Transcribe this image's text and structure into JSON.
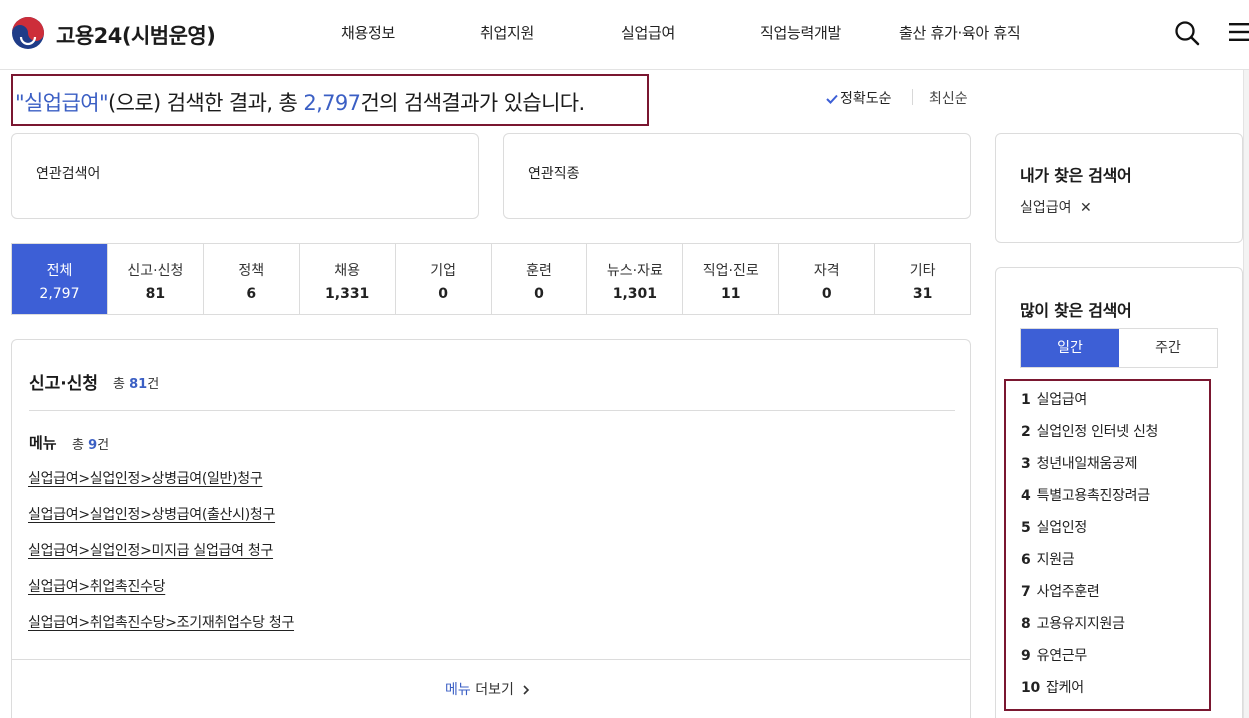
{
  "header": {
    "brand": "고용24(시범운영)",
    "nav": [
      "채용정보",
      "취업지원",
      "실업급여",
      "직업능력개발",
      "출산 휴가·육아 휴직"
    ],
    "icons": [
      "search-icon",
      "hamburger-menu-icon"
    ]
  },
  "result": {
    "keyword_quoted": "\"실업급여\"",
    "mid_text": "(으로) 검색한 결과, 총 ",
    "total": "2,797",
    "end_text": "건의 검색결과가 있습니다."
  },
  "sort": {
    "accuracy": "정확도순",
    "latest": "최신순"
  },
  "related": {
    "keywords_title": "연관검색어",
    "jobs_title": "연관직종"
  },
  "tabs": [
    {
      "label": "전체",
      "count": "2,797"
    },
    {
      "label": "신고·신청",
      "count": "81"
    },
    {
      "label": "정책",
      "count": "6"
    },
    {
      "label": "채용",
      "count": "1,331"
    },
    {
      "label": "기업",
      "count": "0"
    },
    {
      "label": "훈련",
      "count": "0"
    },
    {
      "label": "뉴스·자료",
      "count": "1,301"
    },
    {
      "label": "직업·진로",
      "count": "11"
    },
    {
      "label": "자격",
      "count": "0"
    },
    {
      "label": "기타",
      "count": "31"
    }
  ],
  "section": {
    "title": "신고·신청",
    "total_prefix": "총 ",
    "total": "81",
    "total_suffix": "건",
    "menu_title": "메뉴",
    "menu_prefix": "총 ",
    "menu_total": "9",
    "menu_suffix": "건",
    "links": [
      "실업급여>실업인정>상병급여(일반)청구",
      "실업급여>실업인정>상병급여(출산시)청구",
      "실업급여>실업인정>미지급 실업급여 청구",
      "실업급여>취업촉진수당",
      "실업급여>취업촉진수당>조기재취업수당 청구"
    ],
    "more_prefix": "메뉴",
    "more_suffix": " 더보기"
  },
  "sidebar": {
    "my_searches_title": "내가 찾은 검색어",
    "my_search_term": "실업급여",
    "popular_title": "많이 찾은 검색어",
    "period_tabs": [
      "일간",
      "주간"
    ],
    "ranks": [
      {
        "num": "1",
        "term": "실업급여"
      },
      {
        "num": "2",
        "term": "실업인정 인터넷 신청"
      },
      {
        "num": "3",
        "term": "청년내일채움공제"
      },
      {
        "num": "4",
        "term": "특별고용촉진장려금"
      },
      {
        "num": "5",
        "term": "실업인정"
      },
      {
        "num": "6",
        "term": "지원금"
      },
      {
        "num": "7",
        "term": "사업주훈련"
      },
      {
        "num": "8",
        "term": "고용유지지원금"
      },
      {
        "num": "9",
        "term": "유연근무"
      },
      {
        "num": "10",
        "term": "잡케어"
      }
    ]
  },
  "colors": {
    "accent": "#3d5fd6",
    "highlight_border": "#7a1730"
  }
}
